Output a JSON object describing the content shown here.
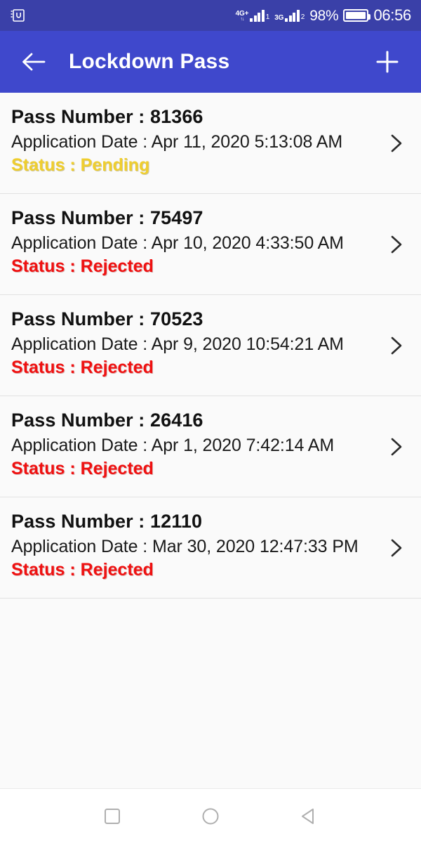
{
  "status_bar": {
    "notification_icon": "app-notification-icon",
    "sim1": {
      "network": "4G+",
      "arrows": "↑↓",
      "signal_bars": 4,
      "sim_label": "1"
    },
    "sim2": {
      "network": "3G",
      "signal_bars": 4,
      "sim_label": "2"
    },
    "battery_percent": "98%",
    "battery_icon": "battery-full-icon",
    "clock": "06:56",
    "background_color": "#3A40A8"
  },
  "app_bar": {
    "back_icon": "arrow-left-icon",
    "title": "Lockdown Pass",
    "add_icon": "plus-icon",
    "background_color": "#3F48CC"
  },
  "list": {
    "chevron_icon": "chevron-right-icon",
    "labels": {
      "pass_prefix": "Pass Number : ",
      "date_prefix": "Application Date : ",
      "status_prefix": "Status : "
    },
    "status_colors": {
      "Pending": "#EFCE2E",
      "Rejected": "#EF1111"
    },
    "items": [
      {
        "pass_line": "Pass Number : 81366",
        "date_line": "Application Date : Apr 11, 2020 5:13:08 AM",
        "status_line": "Status : Pending",
        "pass_number": "81366",
        "application_date": "Apr 11, 2020 5:13:08 AM",
        "status": "Pending"
      },
      {
        "pass_line": "Pass Number : 75497",
        "date_line": "Application Date : Apr 10, 2020 4:33:50 AM",
        "status_line": "Status : Rejected",
        "pass_number": "75497",
        "application_date": "Apr 10, 2020 4:33:50 AM",
        "status": "Rejected"
      },
      {
        "pass_line": "Pass Number : 70523",
        "date_line": "Application Date : Apr 9, 2020 10:54:21 AM",
        "status_line": "Status : Rejected",
        "pass_number": "70523",
        "application_date": "Apr 9, 2020 10:54:21 AM",
        "status": "Rejected"
      },
      {
        "pass_line": "Pass Number : 26416",
        "date_line": "Application Date : Apr 1, 2020 7:42:14 AM",
        "status_line": "Status : Rejected",
        "pass_number": "26416",
        "application_date": "Apr 1, 2020 7:42:14 AM",
        "status": "Rejected"
      },
      {
        "pass_line": "Pass Number : 12110",
        "date_line": "Application Date : Mar 30, 2020 12:47:33 PM",
        "status_line": "Status : Rejected",
        "pass_number": "12110",
        "application_date": "Mar 30, 2020 12:47:33 PM",
        "status": "Rejected"
      }
    ]
  },
  "nav_bar": {
    "recents_icon": "square-recents-icon",
    "home_icon": "circle-home-icon",
    "back_icon": "triangle-back-icon"
  }
}
